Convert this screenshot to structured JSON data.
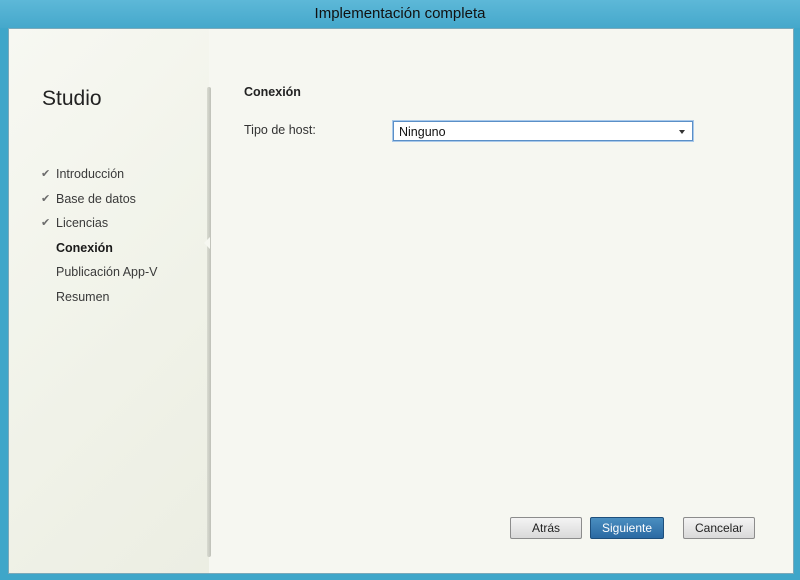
{
  "window": {
    "title": "Implementación completa"
  },
  "sidebar": {
    "brand": "Studio",
    "steps": [
      {
        "label": "Introducción",
        "state": "done"
      },
      {
        "label": "Base de datos",
        "state": "done"
      },
      {
        "label": "Licencias",
        "state": "done"
      },
      {
        "label": "Conexión",
        "state": "current"
      },
      {
        "label": "Publicación App-V",
        "state": "pending"
      },
      {
        "label": "Resumen",
        "state": "pending"
      }
    ]
  },
  "main": {
    "section_title": "Conexión",
    "host_type_label": "Tipo de host:",
    "host_type_value": "Ninguno"
  },
  "buttons": {
    "back": "Atrás",
    "next": "Siguiente",
    "cancel": "Cancelar"
  },
  "colors": {
    "title_bar": "#45a8cb",
    "primary_button": "#2b6aa3"
  }
}
